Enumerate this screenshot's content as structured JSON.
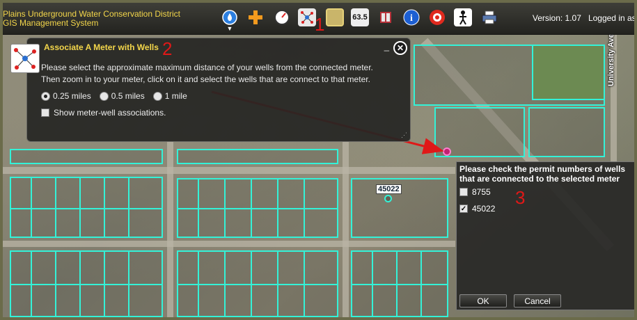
{
  "app": {
    "title": "Plains Underground Water Conservation District GIS Management System",
    "version": "Version: 1.07",
    "logged_in": "Logged in as:"
  },
  "toolbar": {
    "tools": [
      {
        "icon": "water-drop-icon"
      },
      {
        "icon": "add-cross-icon"
      },
      {
        "icon": "gauge-icon"
      },
      {
        "icon": "meter-well-network-icon"
      },
      {
        "icon": "map-layer-icon"
      },
      {
        "icon": "measure-icon",
        "label": "63.5"
      },
      {
        "icon": "book-icon"
      },
      {
        "icon": "info-icon"
      },
      {
        "icon": "target-icon"
      },
      {
        "icon": "person-icon"
      },
      {
        "icon": "printer-icon"
      }
    ]
  },
  "annotations": {
    "one": "1",
    "two": "2",
    "three": "3"
  },
  "map": {
    "street_label": "University Ave",
    "well_label": "45022"
  },
  "dialog": {
    "title": "Associate A Meter with Wells",
    "line1": "Please select the approximate maximum distance of your wells from the connected meter.",
    "line2": "Then zoom in to your meter, click on it and select the wells that are connect to that meter.",
    "radio_options": [
      "0.25 miles",
      "0.5 miles",
      "1 mile"
    ],
    "radio_selected": "0.25 miles",
    "show_associations_label": "Show meter-well associations.",
    "show_associations_checked": false
  },
  "wells_panel": {
    "heading": "Please check the permit numbers of wells that are connected to the selected meter",
    "wells": [
      {
        "permit": "8755",
        "checked": false
      },
      {
        "permit": "45022",
        "checked": true
      }
    ],
    "ok_label": "OK",
    "cancel_label": "Cancel"
  },
  "colors": {
    "parcel_outline": "#33f2d8",
    "title_accent": "#f3d64a",
    "annotation_red": "#e01818"
  }
}
